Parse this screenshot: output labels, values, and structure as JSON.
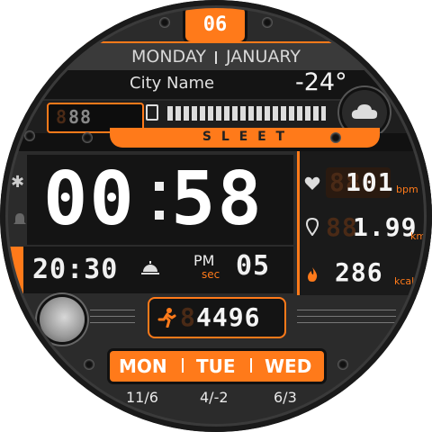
{
  "top": {
    "date_number": "06",
    "weekday": "MONDAY",
    "month": "JANUARY"
  },
  "weather": {
    "city": "City Name",
    "temperature": "-24°",
    "condition": "S L E E T",
    "battery_digits": "88",
    "cloud_icon": "cloud-icon",
    "battery_icon": "battery-icon"
  },
  "time": {
    "hours": "00",
    "minutes": "58",
    "ampm": "PM",
    "sec_label": "sec",
    "seconds": "05",
    "alarm_time": "20:30"
  },
  "stats": {
    "heart_rate": {
      "value": "101",
      "ghost": "888",
      "unit": "bpm"
    },
    "distance": {
      "value": "1.99",
      "ghost": "88",
      "unit": "km"
    },
    "calories": {
      "value": "286",
      "unit": "kcal"
    },
    "steps": {
      "value": "4496",
      "ghost": "8"
    }
  },
  "forecast": {
    "days": [
      "MON",
      "TUE",
      "WED"
    ],
    "temps": [
      "11/6",
      "4/-2",
      "6/3"
    ]
  },
  "icons": [
    "bluetooth-icon",
    "bell-icon",
    "sunrise-icon",
    "heart-icon",
    "location-pin-icon",
    "flame-icon",
    "running-icon",
    "moon-phase-icon"
  ],
  "colors": {
    "accent": "#ff7a1a",
    "background": "#2b2b2b",
    "panel": "#141414",
    "text": "#e9e9e9",
    "ghost_digits": "#4a2a16"
  }
}
